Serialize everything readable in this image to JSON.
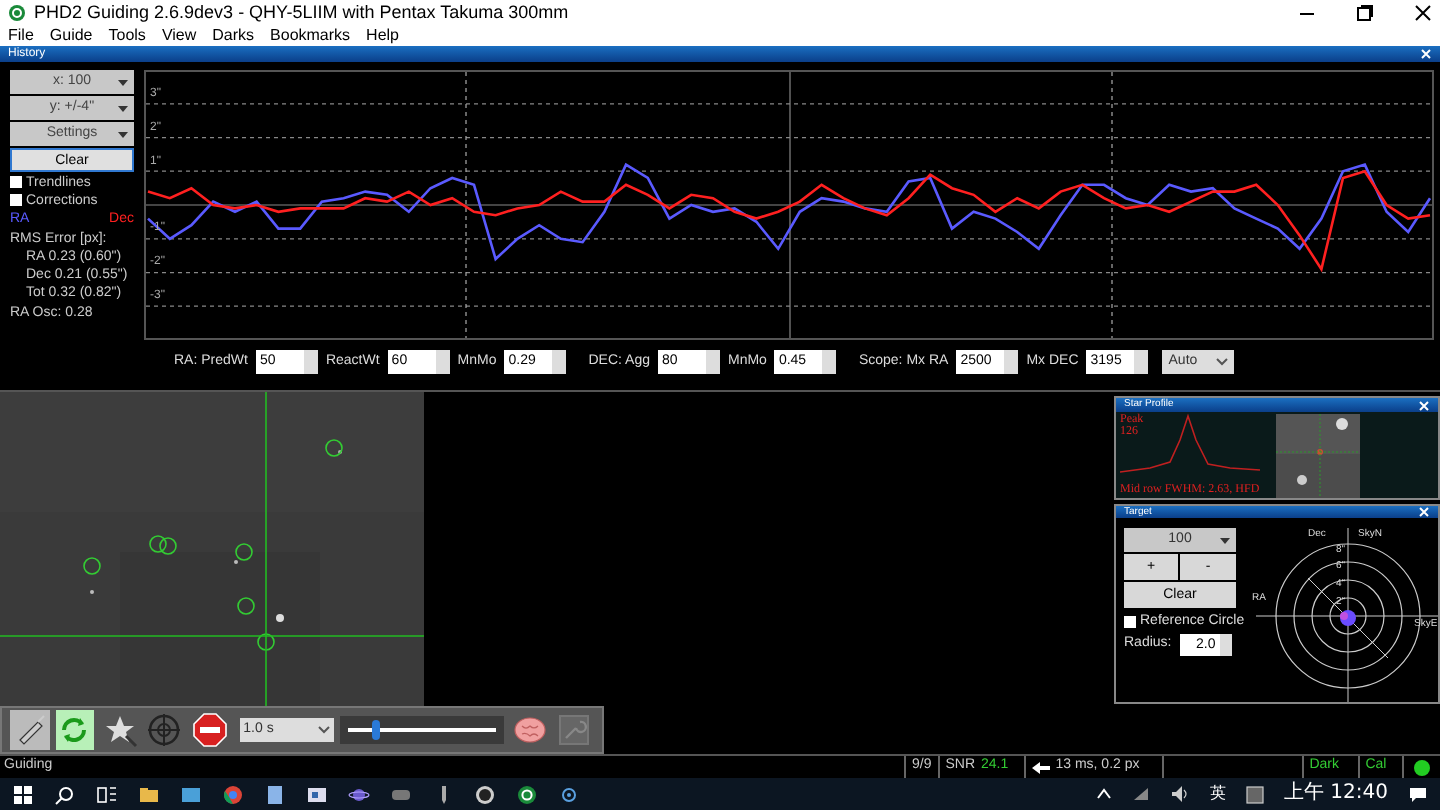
{
  "window": {
    "title": "PHD2 Guiding 2.6.9dev3 - QHY-5LIIM with Pentax Takuma 300mm"
  },
  "menu": [
    "File",
    "Guide",
    "Tools",
    "View",
    "Darks",
    "Bookmarks",
    "Help"
  ],
  "history": {
    "title": "History",
    "dropdowns": [
      "x: 100",
      "y: +/-4\"",
      "Settings"
    ],
    "clear": "Clear",
    "checkboxes": [
      {
        "label": "Trendlines",
        "checked": false
      },
      {
        "label": "Corrections",
        "checked": false
      }
    ],
    "rms_title": "RMS Error [px]:",
    "rms": [
      "RA 0.23 (0.60\")",
      "Dec 0.21 (0.55\")",
      "Tot 0.32 (0.82\")"
    ],
    "osc": "RA Osc: 0.28",
    "chart_data": {
      "type": "line",
      "grid": true,
      "ylim": [
        -4,
        4
      ],
      "yticks": [
        {
          "value": 3,
          "label": "3\""
        },
        {
          "value": 2,
          "label": "2\""
        },
        {
          "value": 1,
          "label": "1\""
        },
        {
          "value": -1,
          "label": "-1\""
        },
        {
          "value": -2,
          "label": "-2\""
        },
        {
          "value": -3,
          "label": "-3\""
        }
      ],
      "series": [
        {
          "name": "RA",
          "color": "#5a5aff",
          "values": [
            -0.4,
            -1.0,
            -0.6,
            0.1,
            -0.2,
            0.1,
            -0.7,
            -0.7,
            0.1,
            0.2,
            0.4,
            0.3,
            -0.2,
            0.5,
            0.8,
            0.6,
            -1.6,
            -1.0,
            -0.6,
            -1.0,
            -1.1,
            -0.2,
            1.2,
            0.8,
            -0.4,
            0,
            -0.2,
            -0.1,
            -0.5,
            -1.3,
            -0.2,
            0.2,
            0.1,
            -0.1,
            -0.2,
            0.7,
            0.8,
            -0.7,
            -0.2,
            -0.4,
            -0.8,
            -1.3,
            -0.3,
            0.6,
            0.6,
            0.2,
            0,
            0.6,
            0.4,
            0.5,
            -0.1,
            -0.4,
            -0.7,
            -1.3,
            -0.4,
            1.0,
            1.2,
            -0.2,
            -0.8,
            0.2
          ]
        },
        {
          "name": "Dec",
          "color": "#ff2020",
          "values": [
            0.4,
            0.2,
            0.5,
            0,
            -0.1,
            0,
            -0.2,
            -0.1,
            -0.1,
            -0.1,
            0.2,
            0.1,
            0.4,
            0,
            0.2,
            -0.2,
            -0.3,
            -0.1,
            0,
            0.4,
            0.1,
            0.1,
            0.6,
            0.3,
            -0.1,
            0.3,
            0.2,
            -0.2,
            -0.4,
            -0.2,
            0.1,
            0.6,
            0.2,
            -0.1,
            -0.3,
            0.2,
            0.9,
            0.5,
            0.3,
            -0.2,
            0.2,
            -0.1,
            0.4,
            0.6,
            0.2,
            -0.1,
            0,
            -0.2,
            0.1,
            0.4,
            0.4,
            0.6,
            0,
            -0.9,
            -1.9,
            0.8,
            1.0,
            0,
            -0.4,
            -0.3
          ]
        }
      ]
    },
    "params": [
      {
        "label": "RA: PredWt",
        "value": "50"
      },
      {
        "label": "ReactWt",
        "value": "60"
      },
      {
        "label": "MnMo",
        "value": "0.29"
      },
      {
        "label": "DEC: Agg",
        "value": "80"
      },
      {
        "label": "MnMo",
        "value": "0.45"
      },
      {
        "label": "Scope: Mx RA",
        "value": "2500"
      },
      {
        "label": "Mx DEC",
        "value": "3195"
      }
    ],
    "mode": "Auto"
  },
  "star_profile": {
    "title": "Star Profile",
    "peak_label": "Peak",
    "peak": "126",
    "fwhm": "Mid row FWHM: 2.63, HFD"
  },
  "target": {
    "title": "Target",
    "zoom": "100",
    "plus": "+",
    "minus": "-",
    "clear": "Clear",
    "reference_circle": {
      "label": "Reference Circle",
      "checked": false
    },
    "radius_label": "Radius:",
    "radius": "2.0",
    "ring_labels": [
      "8\"",
      "6\"",
      "4\"",
      "2\""
    ],
    "axes": [
      "Dec",
      "SkyN",
      "RA",
      "SkyE"
    ]
  },
  "toolbar": {
    "exposure": "1.0 s",
    "level": 0.2
  },
  "status": {
    "state": "Guiding",
    "frames": "9/9",
    "snr_label": "SNR",
    "snr": "24.1",
    "guide": "13 ms, 0.2 px",
    "dark": "Dark",
    "cal": "Cal"
  },
  "taskbar": {
    "ime": "英",
    "clock": "上午 12:40"
  }
}
